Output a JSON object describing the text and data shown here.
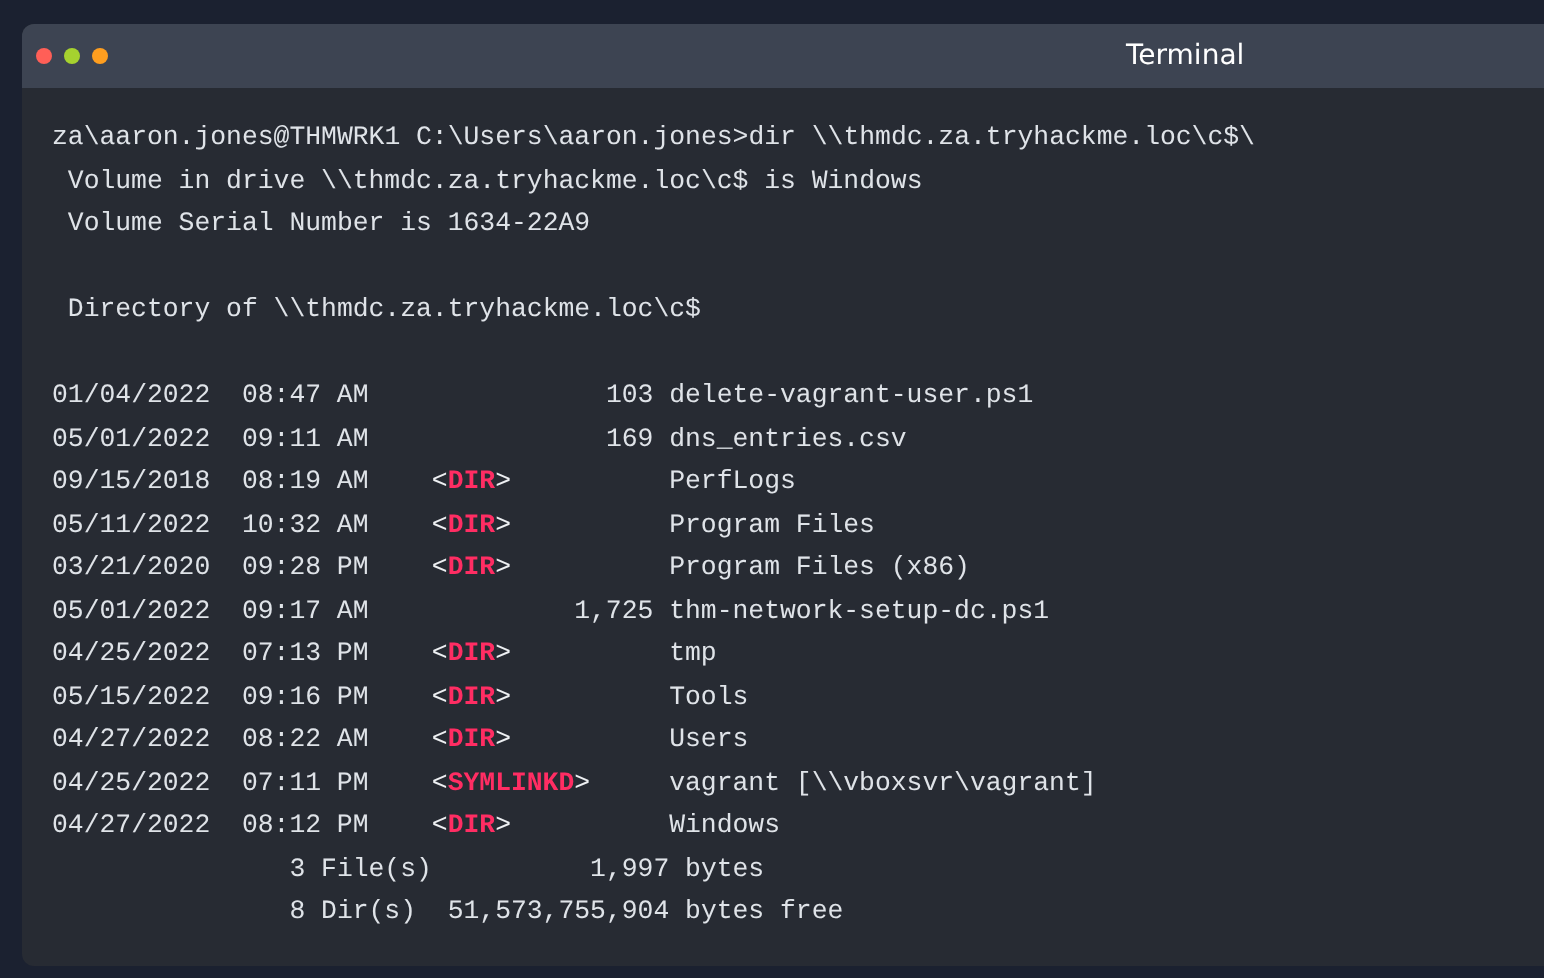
{
  "window": {
    "title": "Terminal"
  },
  "command": {
    "prompt": "za\\aaron.jones@THMWRK1 C:\\Users\\aaron.jones>",
    "input": "dir \\\\thmdc.za.tryhackme.loc\\c$\\"
  },
  "volume_lines": [
    "Volume in drive \\\\thmdc.za.tryhackme.loc\\c$ is Windows",
    "Volume Serial Number is 1634-22A9"
  ],
  "directory_line": "Directory of \\\\thmdc.za.tryhackme.loc\\c$",
  "entries": [
    {
      "kind": "file",
      "date": "01/04/2022",
      "time": "08:47 AM",
      "size": "103",
      "name": "delete-vagrant-user.ps1"
    },
    {
      "kind": "file",
      "date": "05/01/2022",
      "time": "09:11 AM",
      "size": "169",
      "name": "dns_entries.csv"
    },
    {
      "kind": "dir",
      "date": "09/15/2018",
      "time": "08:19 AM",
      "tag": "<DIR>",
      "name": "PerfLogs"
    },
    {
      "kind": "dir",
      "date": "05/11/2022",
      "time": "10:32 AM",
      "tag": "<DIR>",
      "name": "Program Files"
    },
    {
      "kind": "dir",
      "date": "03/21/2020",
      "time": "09:28 PM",
      "tag": "<DIR>",
      "name": "Program Files (x86)"
    },
    {
      "kind": "file",
      "date": "05/01/2022",
      "time": "09:17 AM",
      "size": "1,725",
      "name": "thm-network-setup-dc.ps1"
    },
    {
      "kind": "dir",
      "date": "04/25/2022",
      "time": "07:13 PM",
      "tag": "<DIR>",
      "name": "tmp"
    },
    {
      "kind": "dir",
      "date": "05/15/2022",
      "time": "09:16 PM",
      "tag": "<DIR>",
      "name": "Tools"
    },
    {
      "kind": "dir",
      "date": "04/27/2022",
      "time": "08:22 AM",
      "tag": "<DIR>",
      "name": "Users"
    },
    {
      "kind": "symlink",
      "date": "04/25/2022",
      "time": "07:11 PM",
      "tag": "<SYMLINKD>",
      "name": "vagrant [\\\\vboxsvr\\vagrant]"
    },
    {
      "kind": "dir",
      "date": "04/27/2022",
      "time": "08:12 PM",
      "tag": "<DIR>",
      "name": "Windows"
    }
  ],
  "summary": [
    {
      "count": "3 File(s)",
      "number": "1,997",
      "unit": "bytes"
    },
    {
      "count": "8 Dir(s)",
      "number": "51,573,755,904",
      "unit": "bytes free"
    }
  ]
}
